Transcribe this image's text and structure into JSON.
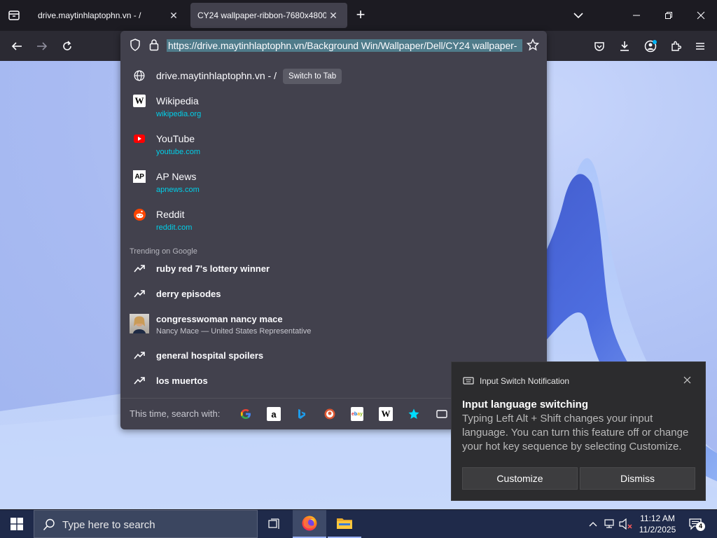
{
  "browser": {
    "tabs": [
      {
        "title": "drive.maytinhlaptophn.vn - /",
        "active": false
      },
      {
        "title": "CY24 wallpaper-ribbon-7680x4800_",
        "active": true
      }
    ],
    "url": "https://drive.maytinhlaptophn.vn/Background Win/Wallpaper/Dell/CY24 wallpaper-"
  },
  "urlbar_popup": {
    "open_tab": {
      "title": "drive.maytinhlaptophn.vn - /",
      "action": "Switch to Tab"
    },
    "shortcuts": [
      {
        "name": "Wikipedia",
        "url": "wikipedia.org",
        "icon": "wikipedia-icon"
      },
      {
        "name": "YouTube",
        "url": "youtube.com",
        "icon": "youtube-icon"
      },
      {
        "name": "AP News",
        "url": "apnews.com",
        "icon": "apnews-icon"
      },
      {
        "name": "Reddit",
        "url": "reddit.com",
        "icon": "reddit-icon"
      }
    ],
    "trending_label": "Trending on Google",
    "trending": [
      {
        "query": "ruby red 7's lottery winner",
        "sub": ""
      },
      {
        "query": "derry episodes",
        "sub": ""
      },
      {
        "query": "congresswoman nancy mace",
        "sub": "Nancy Mace — United States Representative"
      },
      {
        "query": "general hospital spoilers",
        "sub": ""
      },
      {
        "query": "los muertos",
        "sub": ""
      }
    ],
    "search_with_label": "This time, search with:",
    "engines": [
      "google-icon",
      "amazon-icon",
      "bing-icon",
      "duckduckgo-icon",
      "ebay-icon",
      "wikipedia-icon",
      "bookmarks-star-icon",
      "tabs-icon"
    ]
  },
  "notification": {
    "app": "Input Switch Notification",
    "title": "Input language switching",
    "body": "Typing Left Alt + Shift changes your input language. You can turn this feature off or change your hot key sequence by selecting Customize.",
    "buttons": {
      "customize": "Customize",
      "dismiss": "Dismiss"
    }
  },
  "taskbar": {
    "search_placeholder": "Type here to search",
    "time": "11:12 AM",
    "date": "11/2/2025",
    "notification_count": "4"
  },
  "colors": {
    "accent": "#00cfe8",
    "url_selection": "#4f7b8a",
    "popup_bg": "#42414d",
    "toolbar_bg": "#2b2a33",
    "taskbar_bg": "#1f2a4a"
  }
}
